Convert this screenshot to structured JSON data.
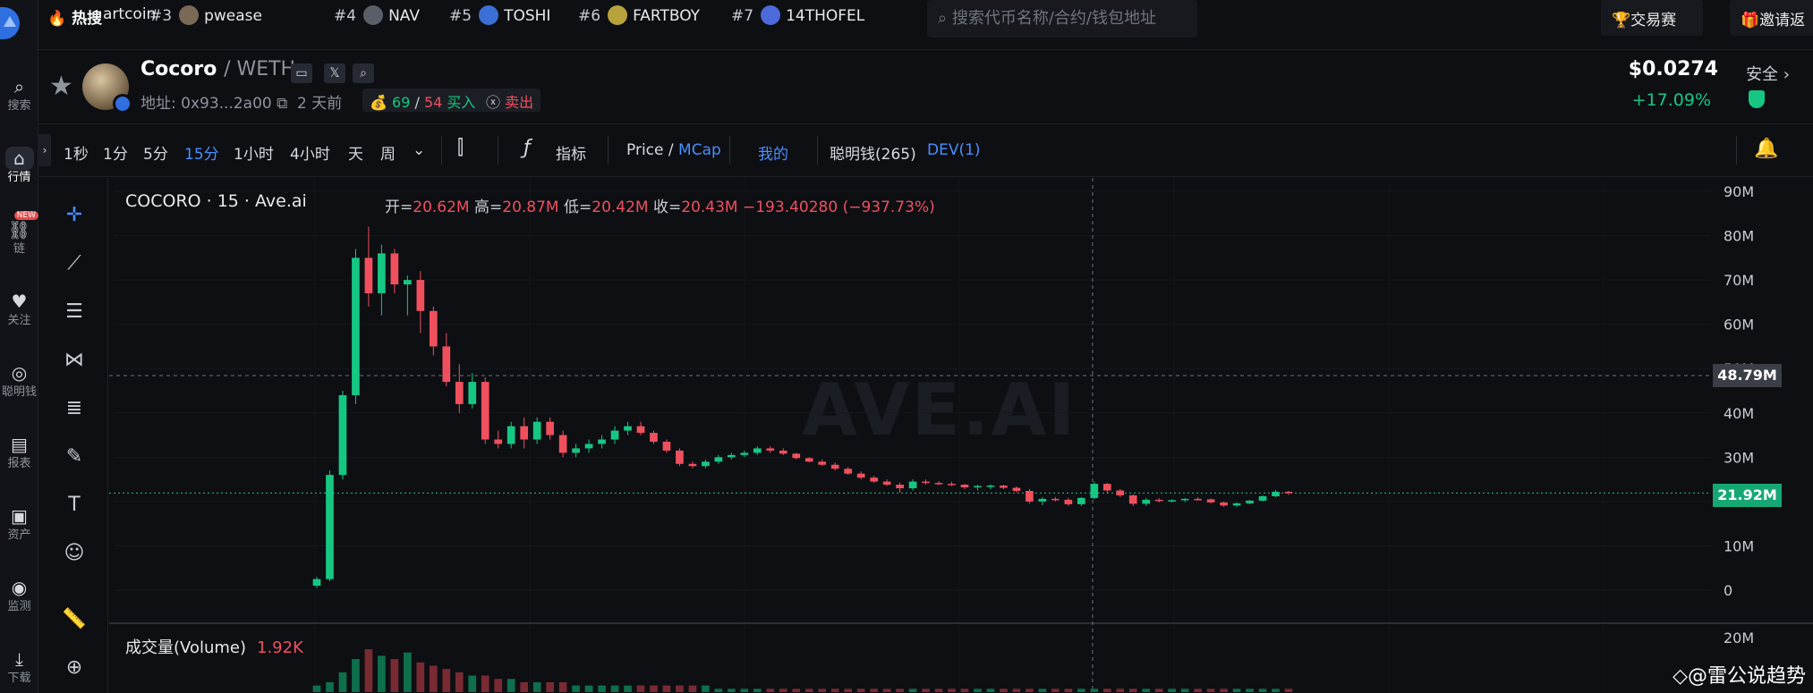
{
  "nav": {
    "items": [
      {
        "label": "搜索",
        "icon": "search-icon"
      },
      {
        "label": "行情",
        "icon": "chart-icon"
      },
      {
        "label": "链",
        "icon": "link-icon",
        "badge": "NEW"
      },
      {
        "label": "关注",
        "icon": "heart-icon"
      },
      {
        "label": "聪明钱",
        "icon": "smart-money-icon"
      },
      {
        "label": "报表",
        "icon": "report-icon"
      },
      {
        "label": "资产",
        "icon": "wallet-icon"
      },
      {
        "label": "监测",
        "icon": "monitor-icon"
      },
      {
        "label": "下载",
        "icon": "download-icon"
      }
    ]
  },
  "topbar": {
    "hot_label": "热搜",
    "tickers": [
      {
        "rank": "",
        "name": "artcoin"
      },
      {
        "rank": "#3",
        "name": "pwease"
      },
      {
        "rank": "#4",
        "name": "NAV"
      },
      {
        "rank": "#5",
        "name": "TOSHI"
      },
      {
        "rank": "#6",
        "name": "FARTBOY"
      },
      {
        "rank": "#7",
        "name": "14THOFEL"
      }
    ],
    "search_placeholder": "搜索代币名称/合约/钱包地址",
    "contest_label": "交易赛",
    "invite_label": "邀请返"
  },
  "token": {
    "name": "Cocoro",
    "quote": "/ WETH",
    "address": "地址: 0x93...2a00",
    "age": "2 天前",
    "buys": "69",
    "sells": "54",
    "buy_label": "买入",
    "sell_label": "卖出",
    "price": "$0.0274",
    "change": "+17.09%",
    "safety": "安全"
  },
  "toolbar": {
    "timeframes": [
      "1秒",
      "1分",
      "5分",
      "15分",
      "1小时",
      "4小时",
      "天",
      "周"
    ],
    "active_timeframe": "15分",
    "indicators_label": "指标",
    "price_label": "Price",
    "mcap_label": "MCap",
    "mine_label": "我的",
    "smart_money_label": "聪明钱(265)",
    "dev_label": "DEV(1)"
  },
  "legend": {
    "title": "COCORO · 15 · Ave.ai",
    "open_label": "开=",
    "open": "20.62M",
    "high_label": "高=",
    "high": "20.87M",
    "low_label": "低=",
    "low": "20.42M",
    "close_label": "收=",
    "close": "20.43M",
    "change": "−193.40280 (−937.73%)"
  },
  "volume": {
    "label": "成交量(Volume)",
    "value": "1.92K"
  },
  "watermark": "AVE.AI",
  "credit": "@雷公说趋势",
  "colors": {
    "up": "#16c784",
    "down": "#f0505e",
    "accent": "#4c8dff",
    "background": "#0d0f13"
  },
  "chart_data": {
    "type": "candlestick",
    "yaxis": {
      "unit": "market cap",
      "ticks": [
        "0",
        "10M",
        "20M",
        "30M",
        "40M",
        "50M",
        "60M",
        "70M",
        "80M",
        "90M"
      ],
      "ylim": [
        0,
        90
      ]
    },
    "volume_axis_ticks": [
      "20M"
    ],
    "crosshair_value": "48.79M",
    "last_value": "21.92M",
    "series": [
      {
        "o": 1,
        "h": 3,
        "l": 0.5,
        "c": 2.5
      },
      {
        "o": 2.5,
        "h": 27,
        "l": 2,
        "c": 26
      },
      {
        "o": 26,
        "h": 45,
        "l": 25,
        "c": 44
      },
      {
        "o": 44,
        "h": 77,
        "l": 42,
        "c": 75
      },
      {
        "o": 75,
        "h": 82,
        "l": 64,
        "c": 67
      },
      {
        "o": 67,
        "h": 78,
        "l": 62,
        "c": 76
      },
      {
        "o": 76,
        "h": 77,
        "l": 67,
        "c": 69
      },
      {
        "o": 69,
        "h": 71,
        "l": 62,
        "c": 70
      },
      {
        "o": 70,
        "h": 72,
        "l": 58,
        "c": 63
      },
      {
        "o": 63,
        "h": 64,
        "l": 53,
        "c": 55
      },
      {
        "o": 55,
        "h": 58,
        "l": 46,
        "c": 47
      },
      {
        "o": 47,
        "h": 51,
        "l": 40,
        "c": 42
      },
      {
        "o": 42,
        "h": 49,
        "l": 41,
        "c": 47
      },
      {
        "o": 47,
        "h": 48,
        "l": 33,
        "c": 34
      },
      {
        "o": 34,
        "h": 36,
        "l": 32,
        "c": 33
      },
      {
        "o": 33,
        "h": 38,
        "l": 32,
        "c": 37
      },
      {
        "o": 37,
        "h": 39,
        "l": 32,
        "c": 34
      },
      {
        "o": 34,
        "h": 39,
        "l": 33,
        "c": 38
      },
      {
        "o": 38,
        "h": 39,
        "l": 34,
        "c": 35
      },
      {
        "o": 35,
        "h": 36,
        "l": 30,
        "c": 31
      },
      {
        "o": 31,
        "h": 33,
        "l": 30,
        "c": 32
      },
      {
        "o": 32,
        "h": 34,
        "l": 31,
        "c": 33
      },
      {
        "o": 33,
        "h": 35,
        "l": 32,
        "c": 34
      },
      {
        "o": 34,
        "h": 37,
        "l": 33,
        "c": 36
      },
      {
        "o": 36,
        "h": 38,
        "l": 35,
        "c": 37
      },
      {
        "o": 37,
        "h": 38,
        "l": 35,
        "c": 35.5
      },
      {
        "o": 35.5,
        "h": 36,
        "l": 33,
        "c": 33.5
      },
      {
        "o": 33.5,
        "h": 34,
        "l": 31,
        "c": 31.5
      },
      {
        "o": 31.5,
        "h": 32,
        "l": 28,
        "c": 28.5
      },
      {
        "o": 28.5,
        "h": 29,
        "l": 27.5,
        "c": 28
      },
      {
        "o": 28,
        "h": 29.5,
        "l": 27.5,
        "c": 29
      },
      {
        "o": 29,
        "h": 30.5,
        "l": 28.5,
        "c": 30
      },
      {
        "o": 30,
        "h": 31,
        "l": 29.5,
        "c": 30.5
      },
      {
        "o": 30.5,
        "h": 31.5,
        "l": 30,
        "c": 31
      },
      {
        "o": 31,
        "h": 32.5,
        "l": 30.5,
        "c": 32
      },
      {
        "o": 32,
        "h": 32.5,
        "l": 31,
        "c": 31.5
      },
      {
        "o": 31.5,
        "h": 32,
        "l": 30.5,
        "c": 30.8
      },
      {
        "o": 30.8,
        "h": 31,
        "l": 29.5,
        "c": 29.8
      },
      {
        "o": 29.8,
        "h": 30,
        "l": 28.8,
        "c": 29
      },
      {
        "o": 29,
        "h": 29.5,
        "l": 28,
        "c": 28.3
      },
      {
        "o": 28.3,
        "h": 28.8,
        "l": 27,
        "c": 27.4
      },
      {
        "o": 27.4,
        "h": 27.8,
        "l": 26,
        "c": 26.3
      },
      {
        "o": 26.3,
        "h": 26.8,
        "l": 25,
        "c": 25.4
      },
      {
        "o": 25.4,
        "h": 25.8,
        "l": 24.2,
        "c": 24.5
      },
      {
        "o": 24.5,
        "h": 25,
        "l": 23.5,
        "c": 23.8
      },
      {
        "o": 23.8,
        "h": 24.3,
        "l": 22,
        "c": 23
      },
      {
        "o": 23,
        "h": 25,
        "l": 22.5,
        "c": 24.5
      },
      {
        "o": 24.5,
        "h": 25,
        "l": 23.8,
        "c": 24.2
      },
      {
        "o": 24.2,
        "h": 24.6,
        "l": 23.8,
        "c": 24
      },
      {
        "o": 24,
        "h": 24.5,
        "l": 23.5,
        "c": 23.8
      },
      {
        "o": 23.8,
        "h": 24,
        "l": 22.8,
        "c": 23.2
      },
      {
        "o": 23.2,
        "h": 23.8,
        "l": 22.5,
        "c": 23.5
      },
      {
        "o": 23.5,
        "h": 23.9,
        "l": 22.8,
        "c": 23.6
      },
      {
        "o": 23.6,
        "h": 23.8,
        "l": 22.8,
        "c": 23.1
      },
      {
        "o": 23.1,
        "h": 23.4,
        "l": 22,
        "c": 22.4
      },
      {
        "o": 22.4,
        "h": 22.8,
        "l": 19.5,
        "c": 20
      },
      {
        "o": 20,
        "h": 21,
        "l": 19.2,
        "c": 20.6
      },
      {
        "o": 20.6,
        "h": 21,
        "l": 20,
        "c": 20.4
      },
      {
        "o": 20.4,
        "h": 20.8,
        "l": 19,
        "c": 19.4
      },
      {
        "o": 19.4,
        "h": 21,
        "l": 19,
        "c": 20.8
      },
      {
        "o": 20.8,
        "h": 24.5,
        "l": 20.5,
        "c": 24
      },
      {
        "o": 24,
        "h": 24.2,
        "l": 22,
        "c": 22.5
      },
      {
        "o": 22.5,
        "h": 22.8,
        "l": 21,
        "c": 21.4
      },
      {
        "o": 21.4,
        "h": 21.6,
        "l": 19,
        "c": 19.5
      },
      {
        "o": 19.5,
        "h": 20.8,
        "l": 19,
        "c": 20.4
      },
      {
        "o": 20.4,
        "h": 20.8,
        "l": 19.8,
        "c": 20.1
      },
      {
        "o": 20.1,
        "h": 20.5,
        "l": 19.8,
        "c": 20.3
      },
      {
        "o": 20.3,
        "h": 20.8,
        "l": 19.9,
        "c": 20.6
      },
      {
        "o": 20.6,
        "h": 21,
        "l": 20.2,
        "c": 20.5
      },
      {
        "o": 20.5,
        "h": 20.7,
        "l": 19.6,
        "c": 19.8
      },
      {
        "o": 19.8,
        "h": 20,
        "l": 18.8,
        "c": 19.1
      },
      {
        "o": 19.1,
        "h": 19.8,
        "l": 18.8,
        "c": 19.6
      },
      {
        "o": 19.6,
        "h": 20.4,
        "l": 19.4,
        "c": 20.2
      },
      {
        "o": 20.2,
        "h": 21.4,
        "l": 20,
        "c": 21.2
      },
      {
        "o": 21.2,
        "h": 22.6,
        "l": 21,
        "c": 22.2
      },
      {
        "o": 22.2,
        "h": 22.4,
        "l": 21.5,
        "c": 21.92
      }
    ],
    "volumes": [
      2,
      3,
      6,
      10,
      13,
      11,
      10,
      12,
      9,
      8,
      7,
      6,
      5,
      5,
      4,
      4,
      3,
      3,
      3,
      3,
      2,
      2,
      2,
      2,
      2,
      2,
      2,
      2,
      2,
      2,
      2,
      1,
      1,
      1,
      1,
      1,
      1,
      1,
      1,
      1,
      1,
      1,
      1,
      1,
      1,
      1,
      1,
      1,
      1,
      1,
      1,
      1,
      1,
      1,
      1,
      1,
      1,
      1,
      1,
      1,
      1,
      1,
      1,
      1,
      1,
      1,
      1,
      1,
      1,
      1,
      1,
      1,
      1,
      1,
      1,
      1
    ]
  }
}
